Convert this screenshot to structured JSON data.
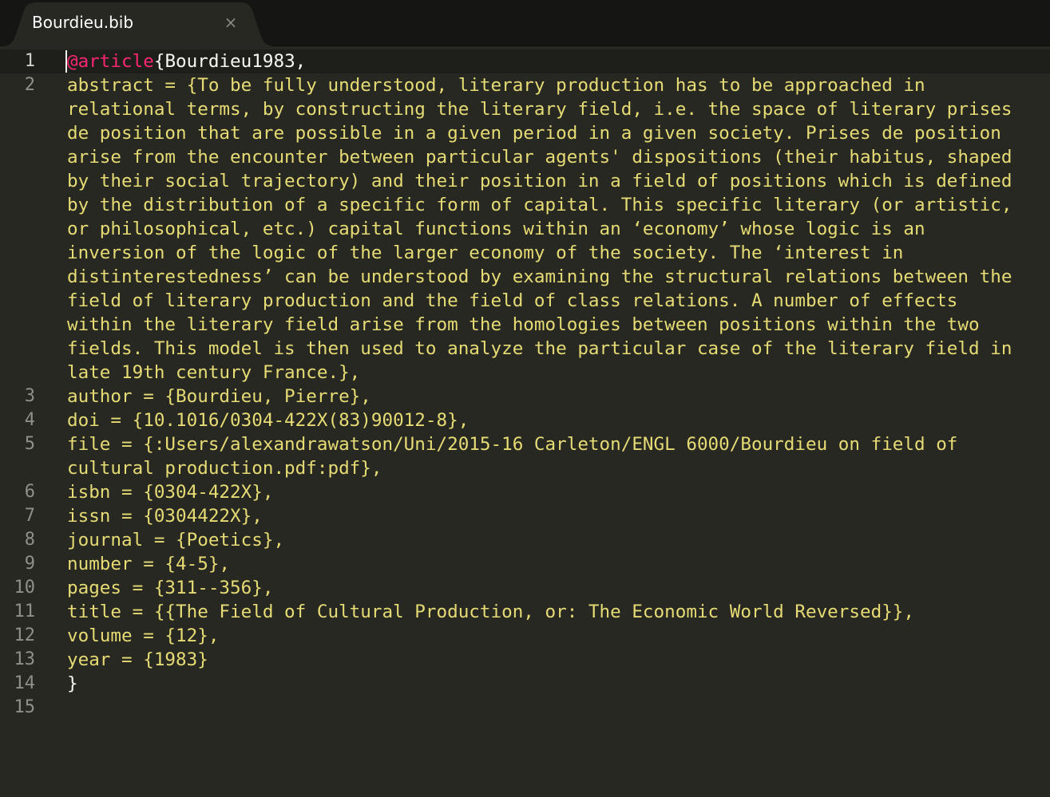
{
  "tab": {
    "title": "Bourdieu.bib",
    "close_glyph": "×"
  },
  "gutter": [
    "1",
    "2",
    "3",
    "4",
    "5",
    "6",
    "7",
    "8",
    "9",
    "10",
    "11",
    "12",
    "13",
    "14",
    "15"
  ],
  "code": {
    "l1_type": "@article",
    "l1_brace": "{",
    "l1_citekey": "Bourdieu1983,",
    "abstract_line1": "abstract = {To be fully understood, literary production has to be approached in",
    "abstract_line2": "relational terms, by constructing the literary field, i.e. the space of literary prises",
    "abstract_line3": "de position that are possible in a given period in a given society. Prises de position",
    "abstract_line4": "arise from the encounter between particular agents' dispositions (their habitus, shaped",
    "abstract_line5": "by their social trajectory) and their position in a field of positions which is defined",
    "abstract_line6": "by the distribution of a specific form of capital. This specific literary (or artistic,",
    "abstract_line7": "or philosophical, etc.) capital functions within an ‘economy’ whose logic is an",
    "abstract_line8": "inversion of the logic of the larger economy of the society. The ‘interest in",
    "abstract_line9": "distinterestedness’ can be understood by examining the structural relations between the",
    "abstract_line10": "field of literary production and the field of class relations. A number of effects",
    "abstract_line11": "within the literary field arise from the homologies between positions within the two",
    "abstract_line12": "fields. This model is then used to analyze the particular case of the literary field in",
    "abstract_line13": "late 19th century France.},",
    "author": "author = {Bourdieu, Pierre},",
    "doi": "doi = {10.1016/0304-422X(83)90012-8},",
    "file_line1": "file = {:Users/alexandrawatson/Uni/2015-16 Carleton/ENGL 6000/Bourdieu on field of",
    "file_line2": "cultural production.pdf:pdf},",
    "isbn": "isbn = {0304-422X},",
    "issn": "issn = {0304422X},",
    "journal": "journal = {Poetics},",
    "number": "number = {4-5},",
    "pages": "pages = {311--356},",
    "title": "title = {{The Field of Cultural Production, or: The Economic World Reversed}},",
    "volume": "volume = {12},",
    "year": "year = {1983}",
    "close_brace": "}"
  },
  "colors": {
    "background": "#272822",
    "keyword": "#f92672",
    "string": "#e6db74",
    "plain": "#f8f8f2",
    "gutter": "#8f908a"
  }
}
